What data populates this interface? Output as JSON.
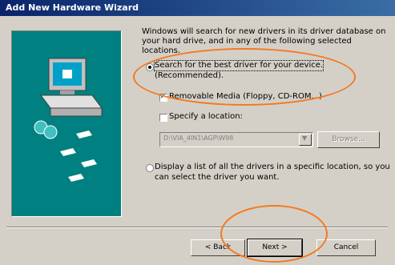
{
  "window": {
    "title": "Add New Hardware Wizard"
  },
  "description": "Windows will search for new drivers in its driver database on your hard drive, and in any of the following selected locations.",
  "options": {
    "search_best_line1": "Search for the best driver for your device.",
    "search_best_line2": "(Recommended).",
    "removable_media": "Removable Media (Floppy, CD-ROM...)",
    "specify_location": "Specify a location:",
    "location_value": "D:\\VIA_4IN1\\AGP\\W98",
    "browse_label": "Browse...",
    "display_list_line1": "Display a list of all the drivers in a specific location, so you",
    "display_list_line2": "can select the driver you want."
  },
  "buttons": {
    "back": "< Back",
    "next": "Next >",
    "cancel": "Cancel"
  },
  "colors": {
    "highlight": "#f47920",
    "sidebar": "#008080",
    "title": "#0a246a"
  }
}
